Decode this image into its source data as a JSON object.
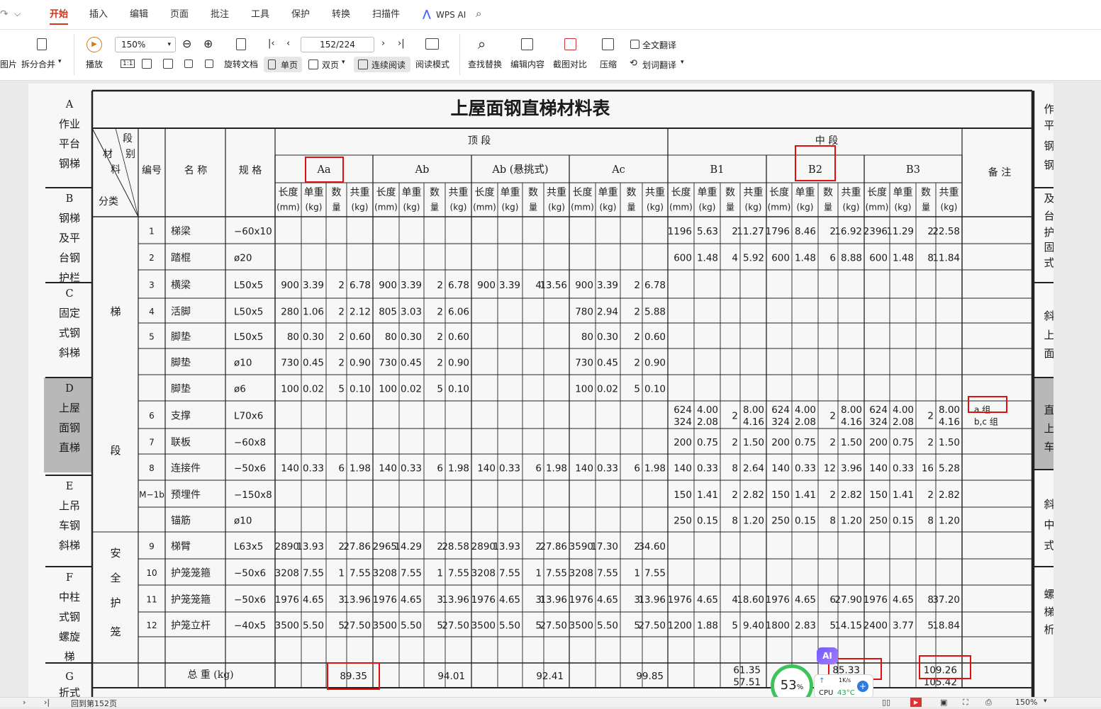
{
  "tabs": [
    "开始",
    "插入",
    "编辑",
    "页面",
    "批注",
    "工具",
    "保护",
    "转换",
    "扫描件"
  ],
  "active_tab": "开始",
  "wps_ai_label": "WPS AI",
  "ribbon": {
    "pic_label": "图片",
    "split_merge": "拆分合并",
    "play": "播放",
    "zoom_value": "150%",
    "rotate": "旋转文档",
    "single": "单页",
    "double": "双页",
    "continuous": "连续阅读",
    "read_mode": "阅读模式",
    "page_value": "152/224",
    "find_replace": "查找替换",
    "edit_content": "编辑内容",
    "screenshot_compare": "截图对比",
    "compress": "压缩",
    "full_translate": "全文翻译",
    "word_translate": "划词翻译",
    "fit_label": "1:1"
  },
  "doc": {
    "title": "上屋面钢直梯材料表",
    "left_nav": [
      {
        "letter": "A",
        "lines": [
          "作业",
          "平台",
          "钢梯"
        ]
      },
      {
        "letter": "B",
        "lines": [
          "钢梯",
          "及平",
          "台钢",
          "护栏"
        ]
      },
      {
        "letter": "C",
        "lines": [
          "固定",
          "式钢",
          "斜梯"
        ]
      },
      {
        "letter": "D",
        "lines": [
          "上屋",
          "面钢",
          "直梯"
        ]
      },
      {
        "letter": "E",
        "lines": [
          "上吊",
          "车钢",
          "斜梯"
        ]
      },
      {
        "letter": "F",
        "lines": [
          "中柱",
          "式钢",
          "螺旋",
          "梯"
        ]
      },
      {
        "letter": "G",
        "lines": [
          "折式"
        ]
      }
    ],
    "right_nav": [
      "作",
      "平",
      "钢",
      "钢",
      "及",
      "台",
      "护",
      "固",
      "式",
      "斜",
      "上",
      "面",
      "直",
      "上",
      "车",
      "斜",
      "中",
      "式",
      "螺",
      "梯",
      "析"
    ],
    "header": {
      "corner_top": "段",
      "corner_top2": "别",
      "corner_mid": "材",
      "corner_mid2": "料",
      "corner_bot": "分类",
      "col_no": "编号",
      "col_name": "名 称",
      "col_spec": "规 格",
      "group_top": "顶          段",
      "group_mid": "中          段",
      "remark": "备     注",
      "segments": [
        "Aa",
        "Ab",
        "Ab (悬挑式)",
        "Ac",
        "B1",
        "B2",
        "B3"
      ],
      "sub": [
        [
          "长度",
          "(mm)"
        ],
        [
          "单重",
          "(kg)"
        ],
        [
          "数",
          "量"
        ],
        [
          "共重",
          "(kg)"
        ]
      ]
    },
    "categories": [
      {
        "label": "梯",
        "row": 3
      },
      {
        "label": "段",
        "row": 8
      },
      {
        "label": "安",
        "row": 11
      },
      {
        "label": "全",
        "row": 12
      },
      {
        "label": "护",
        "row": 13
      },
      {
        "label": "笼",
        "row": 14
      }
    ],
    "rows": [
      {
        "no": "1",
        "name": "梯梁",
        "spec": "−60x10",
        "cells": [
          "",
          "",
          "",
          "",
          "",
          "",
          "",
          "",
          "",
          "",
          "",
          "",
          "",
          "",
          "",
          "",
          "1196",
          "5.63",
          "2",
          "11.27",
          "1796",
          "8.46",
          "2",
          "16.92",
          "2396",
          "11.29",
          "2",
          "22.58"
        ]
      },
      {
        "no": "2",
        "name": "踏棍",
        "spec": "ø20",
        "cells": [
          "",
          "",
          "",
          "",
          "",
          "",
          "",
          "",
          "",
          "",
          "",
          "",
          "",
          "",
          "",
          "",
          "600",
          "1.48",
          "4",
          "5.92",
          "600",
          "1.48",
          "6",
          "8.88",
          "600",
          "1.48",
          "8",
          "11.84"
        ]
      },
      {
        "no": "3",
        "name": "横梁",
        "spec": "L50x5",
        "cells": [
          "900",
          "3.39",
          "2",
          "6.78",
          "900",
          "3.39",
          "2",
          "6.78",
          "900",
          "3.39",
          "4",
          "13.56",
          "900",
          "3.39",
          "2",
          "6.78",
          "",
          "",
          "",
          "",
          "",
          "",
          "",
          "",
          "",
          "",
          "",
          ""
        ]
      },
      {
        "no": "4",
        "name": "活脚",
        "spec": "L50x5",
        "cells": [
          "280",
          "1.06",
          "2",
          "2.12",
          "805",
          "3.03",
          "2",
          "6.06",
          "",
          "",
          "",
          "",
          "780",
          "2.94",
          "2",
          "5.88",
          "",
          "",
          "",
          "",
          "",
          "",
          "",
          "",
          "",
          "",
          "",
          ""
        ]
      },
      {
        "no": "5",
        "name": "脚垫",
        "spec": "L50x5",
        "cells": [
          "80",
          "0.30",
          "2",
          "0.60",
          "80",
          "0.30",
          "2",
          "0.60",
          "",
          "",
          "",
          "",
          "80",
          "0.30",
          "2",
          "0.60",
          "",
          "",
          "",
          "",
          "",
          "",
          "",
          "",
          "",
          "",
          "",
          ""
        ]
      },
      {
        "no": "",
        "name": "脚垫",
        "spec": "ø10",
        "cells": [
          "730",
          "0.45",
          "2",
          "0.90",
          "730",
          "0.45",
          "2",
          "0.90",
          "",
          "",
          "",
          "",
          "730",
          "0.45",
          "2",
          "0.90",
          "",
          "",
          "",
          "",
          "",
          "",
          "",
          "",
          "",
          "",
          "",
          ""
        ]
      },
      {
        "no": "",
        "name": "脚垫",
        "spec": "ø6",
        "cells": [
          "100",
          "0.02",
          "5",
          "0.10",
          "100",
          "0.02",
          "5",
          "0.10",
          "",
          "",
          "",
          "",
          "100",
          "0.02",
          "5",
          "0.10",
          "",
          "",
          "",
          "",
          "",
          "",
          "",
          "",
          "",
          "",
          "",
          ""
        ]
      },
      {
        "no": "6",
        "name": "支撑",
        "spec": "L70x6",
        "cells": [
          "",
          "",
          "",
          "",
          "",
          "",
          "",
          "",
          "",
          "",
          "",
          "",
          "",
          "",
          "",
          "",
          "624\n324",
          "4.00\n2.08",
          "2",
          "8.00\n4.16",
          "624\n324",
          "4.00\n2.08",
          "2",
          "8.00\n4.16",
          "624\n324",
          "4.00\n2.08",
          "2",
          "8.00\n4.16"
        ],
        "remark": "a 组\nb,c 组"
      },
      {
        "no": "7",
        "name": "联板",
        "spec": "−60x8",
        "cells": [
          "",
          "",
          "",
          "",
          "",
          "",
          "",
          "",
          "",
          "",
          "",
          "",
          "",
          "",
          "",
          "",
          "200",
          "0.75",
          "2",
          "1.50",
          "200",
          "0.75",
          "2",
          "1.50",
          "200",
          "0.75",
          "2",
          "1.50"
        ]
      },
      {
        "no": "8",
        "name": "连接件",
        "spec": "−50x6",
        "cells": [
          "140",
          "0.33",
          "6",
          "1.98",
          "140",
          "0.33",
          "6",
          "1.98",
          "140",
          "0.33",
          "6",
          "1.98",
          "140",
          "0.33",
          "6",
          "1.98",
          "140",
          "0.33",
          "8",
          "2.64",
          "140",
          "0.33",
          "12",
          "3.96",
          "140",
          "0.33",
          "16",
          "5.28"
        ]
      },
      {
        "no": "M−1b",
        "name": "预埋件",
        "spec": "−150x8",
        "cells": [
          "",
          "",
          "",
          "",
          "",
          "",
          "",
          "",
          "",
          "",
          "",
          "",
          "",
          "",
          "",
          "",
          "150",
          "1.41",
          "2",
          "2.82",
          "150",
          "1.41",
          "2",
          "2.82",
          "150",
          "1.41",
          "2",
          "2.82"
        ]
      },
      {
        "no": "",
        "name": "锚筋",
        "spec": "ø10",
        "cells": [
          "",
          "",
          "",
          "",
          "",
          "",
          "",
          "",
          "",
          "",
          "",
          "",
          "",
          "",
          "",
          "",
          "250",
          "0.15",
          "8",
          "1.20",
          "250",
          "0.15",
          "8",
          "1.20",
          "250",
          "0.15",
          "8",
          "1.20"
        ]
      },
      {
        "no": "9",
        "name": "梯臂",
        "spec": "L63x5",
        "cells": [
          "2890",
          "13.93",
          "2",
          "27.86",
          "2965",
          "14.29",
          "2",
          "28.58",
          "2890",
          "13.93",
          "2",
          "27.86",
          "3590",
          "17.30",
          "2",
          "34.60",
          "",
          "",
          "",
          "",
          "",
          "",
          "",
          "",
          "",
          "",
          "",
          ""
        ]
      },
      {
        "no": "10",
        "name": "护笼笼箍",
        "spec": "−50x6",
        "cells": [
          "3208",
          "7.55",
          "1",
          "7.55",
          "3208",
          "7.55",
          "1",
          "7.55",
          "3208",
          "7.55",
          "1",
          "7.55",
          "3208",
          "7.55",
          "1",
          "7.55",
          "",
          "",
          "",
          "",
          "",
          "",
          "",
          "",
          "",
          "",
          "",
          ""
        ]
      },
      {
        "no": "11",
        "name": "护笼笼箍",
        "spec": "−50x6",
        "cells": [
          "1976",
          "4.65",
          "3",
          "13.96",
          "1976",
          "4.65",
          "3",
          "13.96",
          "1976",
          "4.65",
          "3",
          "13.96",
          "1976",
          "4.65",
          "3",
          "13.96",
          "1976",
          "4.65",
          "4",
          "18.60",
          "1976",
          "4.65",
          "6",
          "27.90",
          "1976",
          "4.65",
          "8",
          "37.20"
        ]
      },
      {
        "no": "12",
        "name": "护笼立杆",
        "spec": "−40x5",
        "cells": [
          "3500",
          "5.50",
          "5",
          "27.50",
          "3500",
          "5.50",
          "5",
          "27.50",
          "3500",
          "5.50",
          "5",
          "27.50",
          "3500",
          "5.50",
          "5",
          "27.50",
          "1200",
          "1.88",
          "5",
          "9.40",
          "1800",
          "2.83",
          "5",
          "14.15",
          "2400",
          "3.77",
          "5",
          "18.84"
        ]
      }
    ],
    "total_label": "总    重 (kg)",
    "totals": [
      "89.35",
      "94.01",
      "92.41",
      "99.85",
      "61.35\n57.51",
      "85.33\n",
      "109.26\n105.42"
    ]
  },
  "widgets": {
    "progress_percent": "53",
    "percent_sign": "%",
    "cpu_label": "CPU",
    "cpu_temp": "43°C",
    "net_speed": "1K/s",
    "ai_badge": "AI"
  },
  "status": {
    "back_label": "回到第152页",
    "zoom": "150%"
  },
  "colors": {
    "accent": "#d4341b",
    "highlight": "#e01010",
    "gauge": "#3cc35a",
    "cpu_temp": "#1fa34a"
  }
}
